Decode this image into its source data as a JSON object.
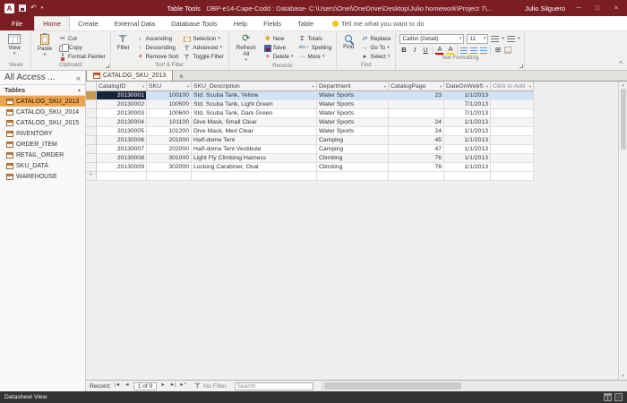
{
  "colors": {
    "accent": "#7b1e24",
    "nav_selected": "#eda452",
    "row_selected": "#cfe3f6",
    "active_cell": "#17243d"
  },
  "glyphs": {
    "app": "A",
    "undo": "↶",
    "qat_dropdown": "▾",
    "minimize": "─",
    "maximize": "□",
    "close": "×",
    "dropdown": "▾",
    "chevron_left": "«",
    "group_collapse": "▴",
    "collapse_ribbon": "^",
    "cut": "✂",
    "refresh": "⟳",
    "new": "✱",
    "delete": "×",
    "totals": "Σ",
    "spelling": "abc✓",
    "more": "···",
    "ascending": "↓",
    "descending": "↑",
    "remove_sort": "×",
    "replace": "⇄",
    "go_to": "→",
    "select": "▸",
    "gridlines": "⊞",
    "first": "|◄",
    "previous": "◄",
    "next": "►",
    "last": "►|",
    "new_record": "►*",
    "scroll_up": "▲",
    "scroll_down": "▼",
    "star_row": "*",
    "tab_close": "×"
  },
  "title_bar": {
    "contextual_label": "Table Tools",
    "document_title": "DBP-e14-Cape-Codd : Database- C:\\Users\\Onel\\OneDrive\\Desktop\\Julio homework\\Project 7\\...",
    "user_name": "Julio Silguero",
    "controls": [
      "─",
      "□",
      "×"
    ]
  },
  "ribbon": {
    "tabs": [
      {
        "label": "File",
        "file": true
      },
      {
        "label": "Home",
        "active": true
      },
      {
        "label": "Create"
      },
      {
        "label": "External Data"
      },
      {
        "label": "Database Tools"
      },
      {
        "label": "Help"
      },
      {
        "label": "Fields"
      },
      {
        "label": "Table"
      }
    ],
    "tell_me": "Tell me what you want to do",
    "views_group": {
      "label": "Views",
      "view": "View"
    },
    "clipboard_group": {
      "label": "Clipboard",
      "paste": "Paste",
      "cut": "Cut",
      "copy": "Copy",
      "format_painter": "Format Painter"
    },
    "sort_filter_group": {
      "label": "Sort & Filter",
      "filter": "Filter",
      "ascending": "Ascending",
      "descending": "Descending",
      "remove_sort": "Remove Sort",
      "selection": "Selection",
      "advanced": "Advanced",
      "toggle_filter": "Toggle Filter"
    },
    "records_group": {
      "label": "Records",
      "refresh_all": "Refresh All",
      "new": "New",
      "save": "Save",
      "delete": "Delete",
      "totals": "Totals",
      "spelling": "Spelling",
      "more": "More"
    },
    "find_group": {
      "label": "Find",
      "find": "Find",
      "replace": "Replace",
      "go_to": "Go To",
      "select": "Select"
    },
    "text_formatting_group": {
      "label": "Text Formatting",
      "font_name": "Calibri (Detail)",
      "font_size": "11",
      "bold": "B",
      "italic": "I",
      "underline": "U",
      "font_color": "A",
      "highlight": "A"
    }
  },
  "nav_pane": {
    "title": "All Access ...",
    "group_header": "Tables",
    "items": [
      {
        "label": "CATALOG_SKU_2013",
        "selected": true
      },
      {
        "label": "CATALOG_SKU_2014"
      },
      {
        "label": "CATALOG_SKU_2015"
      },
      {
        "label": "INVENTORY"
      },
      {
        "label": "ORDER_ITEM"
      },
      {
        "label": "RETAIL_ORDER"
      },
      {
        "label": "SKU_DATA"
      },
      {
        "label": "WAREHOUSE"
      }
    ]
  },
  "datasheet": {
    "tab_title": "CATALOG_SKU_2013",
    "columns": [
      {
        "label": "CatalogID"
      },
      {
        "label": "SKU"
      },
      {
        "label": "SKU_Description"
      },
      {
        "label": "Department"
      },
      {
        "label": "CatalogPage"
      },
      {
        "label": "DateOnWebS"
      },
      {
        "label": "Click to Add",
        "placeholder": true
      }
    ],
    "rows": [
      [
        "20130001",
        "100100",
        "Std. Scuba Tank, Yellow",
        "Water Sports",
        "23",
        "1/1/2013"
      ],
      [
        "20130002",
        "100500",
        "Std. Scuba Tank, Light Green",
        "Water Sports",
        "",
        "7/1/2013"
      ],
      [
        "20130003",
        "100600",
        "Std. Scuba Tank, Dark Green",
        "Water Sports",
        "",
        "7/1/2013"
      ],
      [
        "20130004",
        "101100",
        "Dive Mask, Small Clear",
        "Water Sports",
        "24",
        "1/1/2013"
      ],
      [
        "20130005",
        "101200",
        "Dive Mask, Med Clear",
        "Water Sports",
        "24",
        "1/1/2013"
      ],
      [
        "20130006",
        "201000",
        "Half-dome Tent",
        "Camping",
        "45",
        "1/1/2013"
      ],
      [
        "20130007",
        "202000",
        "Half-dome Tent Vestibule",
        "Camping",
        "47",
        "1/1/2013"
      ],
      [
        "20130008",
        "301000",
        "Light Fly Climbing Harness",
        "Climbing",
        "76",
        "1/1/2013"
      ],
      [
        "20130009",
        "302000",
        "Locking Carabiner, Oval",
        "Climbing",
        "78",
        "1/1/2013"
      ]
    ]
  },
  "record_nav": {
    "label": "Record:",
    "position": "1 of 9",
    "no_filter": "No Filter",
    "search_placeholder": "Search"
  },
  "status_bar": {
    "view_name": "Datasheet View"
  }
}
